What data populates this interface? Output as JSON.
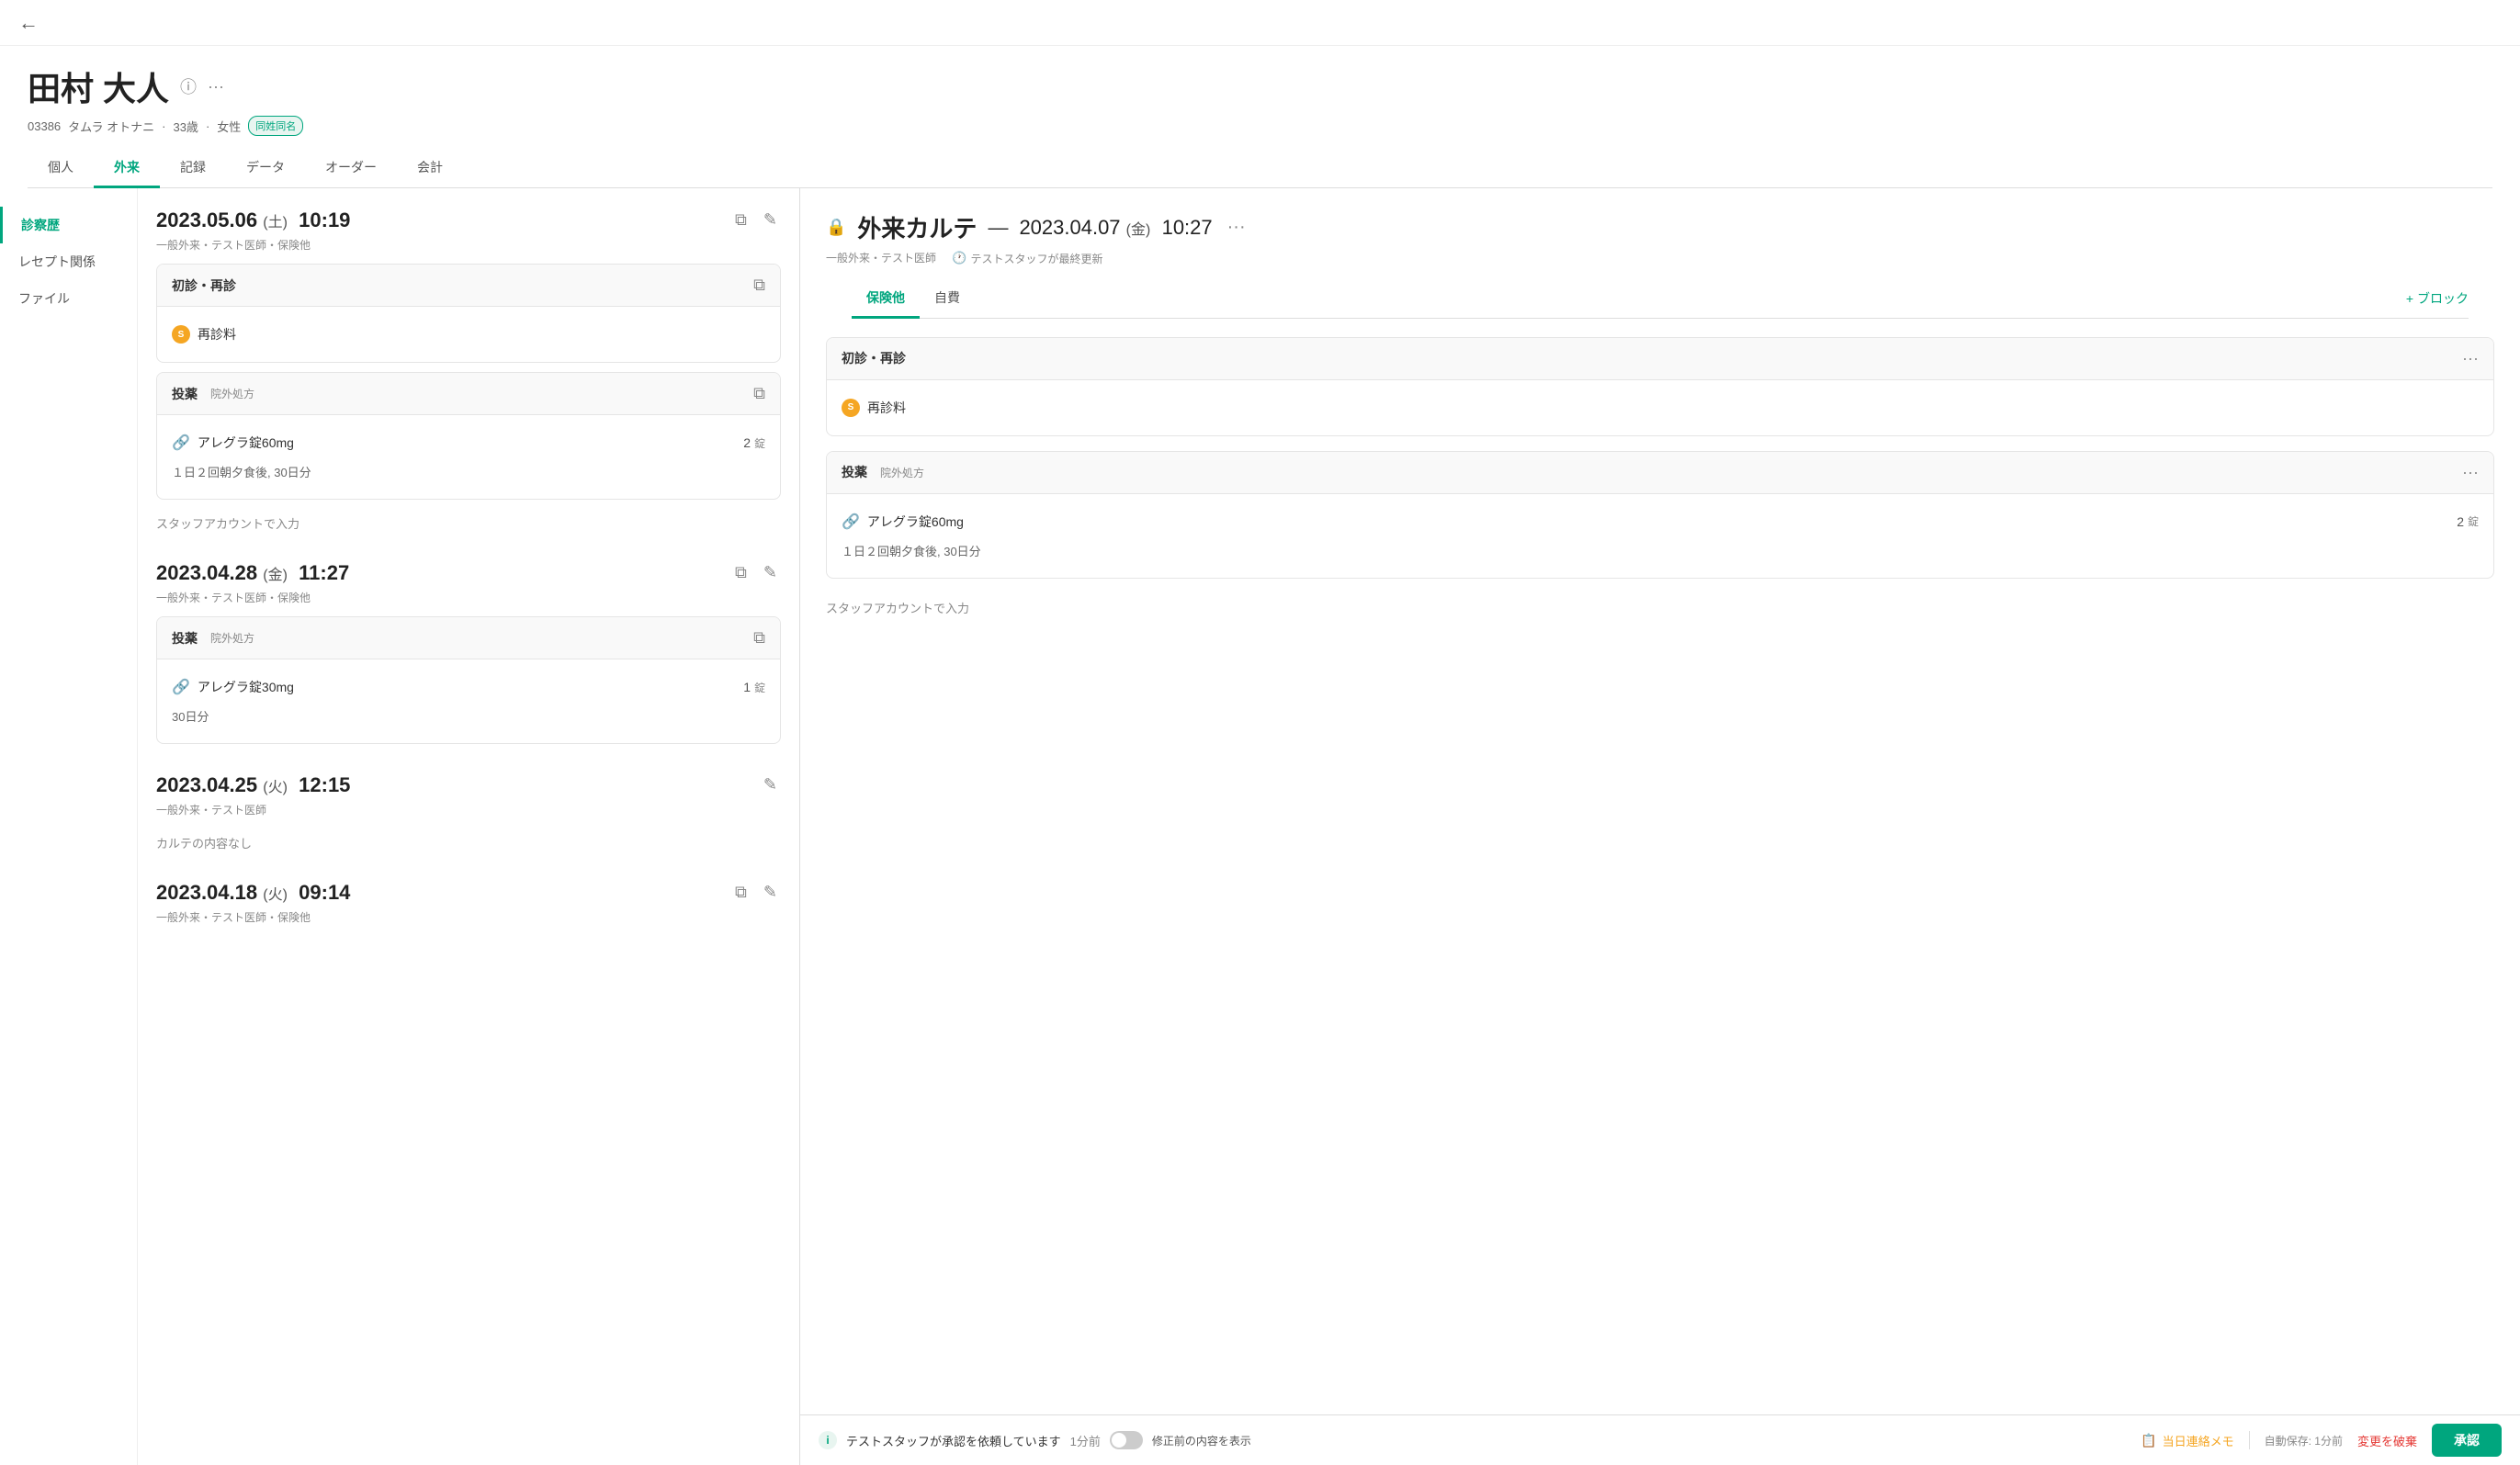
{
  "topbar": {
    "back_label": "←"
  },
  "patient": {
    "name": "田村 大人",
    "id": "03386",
    "name_kana": "タムラ オトナニ",
    "age": "33歳",
    "gender": "女性",
    "same_name_badge": "同姓同名"
  },
  "nav_tabs": [
    {
      "label": "個人",
      "active": false
    },
    {
      "label": "外来",
      "active": true
    },
    {
      "label": "記録",
      "active": false
    },
    {
      "label": "データ",
      "active": false
    },
    {
      "label": "オーダー",
      "active": false
    },
    {
      "label": "会計",
      "active": false
    }
  ],
  "sidebar": {
    "items": [
      {
        "label": "診察歴",
        "active": true
      },
      {
        "label": "レセプト関係",
        "active": false
      },
      {
        "label": "ファイル",
        "active": false
      }
    ]
  },
  "visits": [
    {
      "date": "2023.05.06",
      "day_of_week": "(土)",
      "time": "10:19",
      "meta": "一般外来・テスト医師・保険他",
      "has_copy": true,
      "has_edit": true,
      "cards": [
        {
          "type": "shinsin",
          "title": "初診・再診",
          "items": [
            {
              "name": "再診料",
              "type": "shinsin"
            }
          ]
        },
        {
          "type": "medicine",
          "title": "投薬",
          "subtitle": "院外処方",
          "items": [
            {
              "name": "アレグラ錠60mg",
              "qty": 2,
              "unit": "錠",
              "dosage": "１日２回朝夕食後, 30日分"
            }
          ]
        }
      ],
      "staff_input": "スタッフアカウントで入力"
    },
    {
      "date": "2023.04.28",
      "day_of_week": "(金)",
      "time": "11:27",
      "meta": "一般外来・テスト医師・保険他",
      "has_copy": true,
      "has_edit": true,
      "cards": [
        {
          "type": "medicine",
          "title": "投薬",
          "subtitle": "院外処方",
          "items": [
            {
              "name": "アレグラ錠30mg",
              "qty": 1,
              "unit": "錠",
              "dosage": "30日分"
            }
          ]
        }
      ],
      "staff_input": null
    },
    {
      "date": "2023.04.25",
      "day_of_week": "(火)",
      "time": "12:15",
      "meta": "一般外来・テスト医師",
      "has_copy": false,
      "has_edit": true,
      "cards": [],
      "note": "カルテの内容なし",
      "staff_input": null
    },
    {
      "date": "2023.04.18",
      "day_of_week": "(火)",
      "time": "09:14",
      "meta": "一般外来・テスト医師・保険他",
      "has_copy": true,
      "has_edit": true,
      "cards": [],
      "staff_input": null
    }
  ],
  "right_panel": {
    "lock_icon": "🔒",
    "title": "外来カルテ",
    "separator": "—",
    "date": "2023.04.07",
    "day_of_week": "(金)",
    "time": "10:27",
    "more_label": "···",
    "meta_type": "一般外来・テスト医師",
    "meta_updated": "テストスタッフが最終更新",
    "tabs": [
      {
        "label": "保険他",
        "active": true
      },
      {
        "label": "自費",
        "active": false
      }
    ],
    "add_block_label": "+ ブロック",
    "cards": [
      {
        "title": "初診・再診",
        "items": [
          {
            "name": "再診料",
            "type": "shinsin"
          }
        ]
      },
      {
        "title": "投薬",
        "subtitle": "院外処方",
        "items": [
          {
            "name": "アレグラ錠60mg",
            "qty": 2,
            "unit": "錠",
            "dosage": "１日２回朝夕食後, 30日分"
          }
        ]
      }
    ],
    "staff_input": "スタッフアカウントで入力"
  },
  "bottom_bar": {
    "info_icon": "i",
    "approval_text": "テストスタッフが承認を依頼しています",
    "approval_time": "1分前",
    "toggle_label": "修正前の内容を表示",
    "contact_memo_label": "当日連絡メモ",
    "autosave_label": "自動保存: 1分前",
    "revert_label": "変更を破棄",
    "approve_label": "承認"
  }
}
